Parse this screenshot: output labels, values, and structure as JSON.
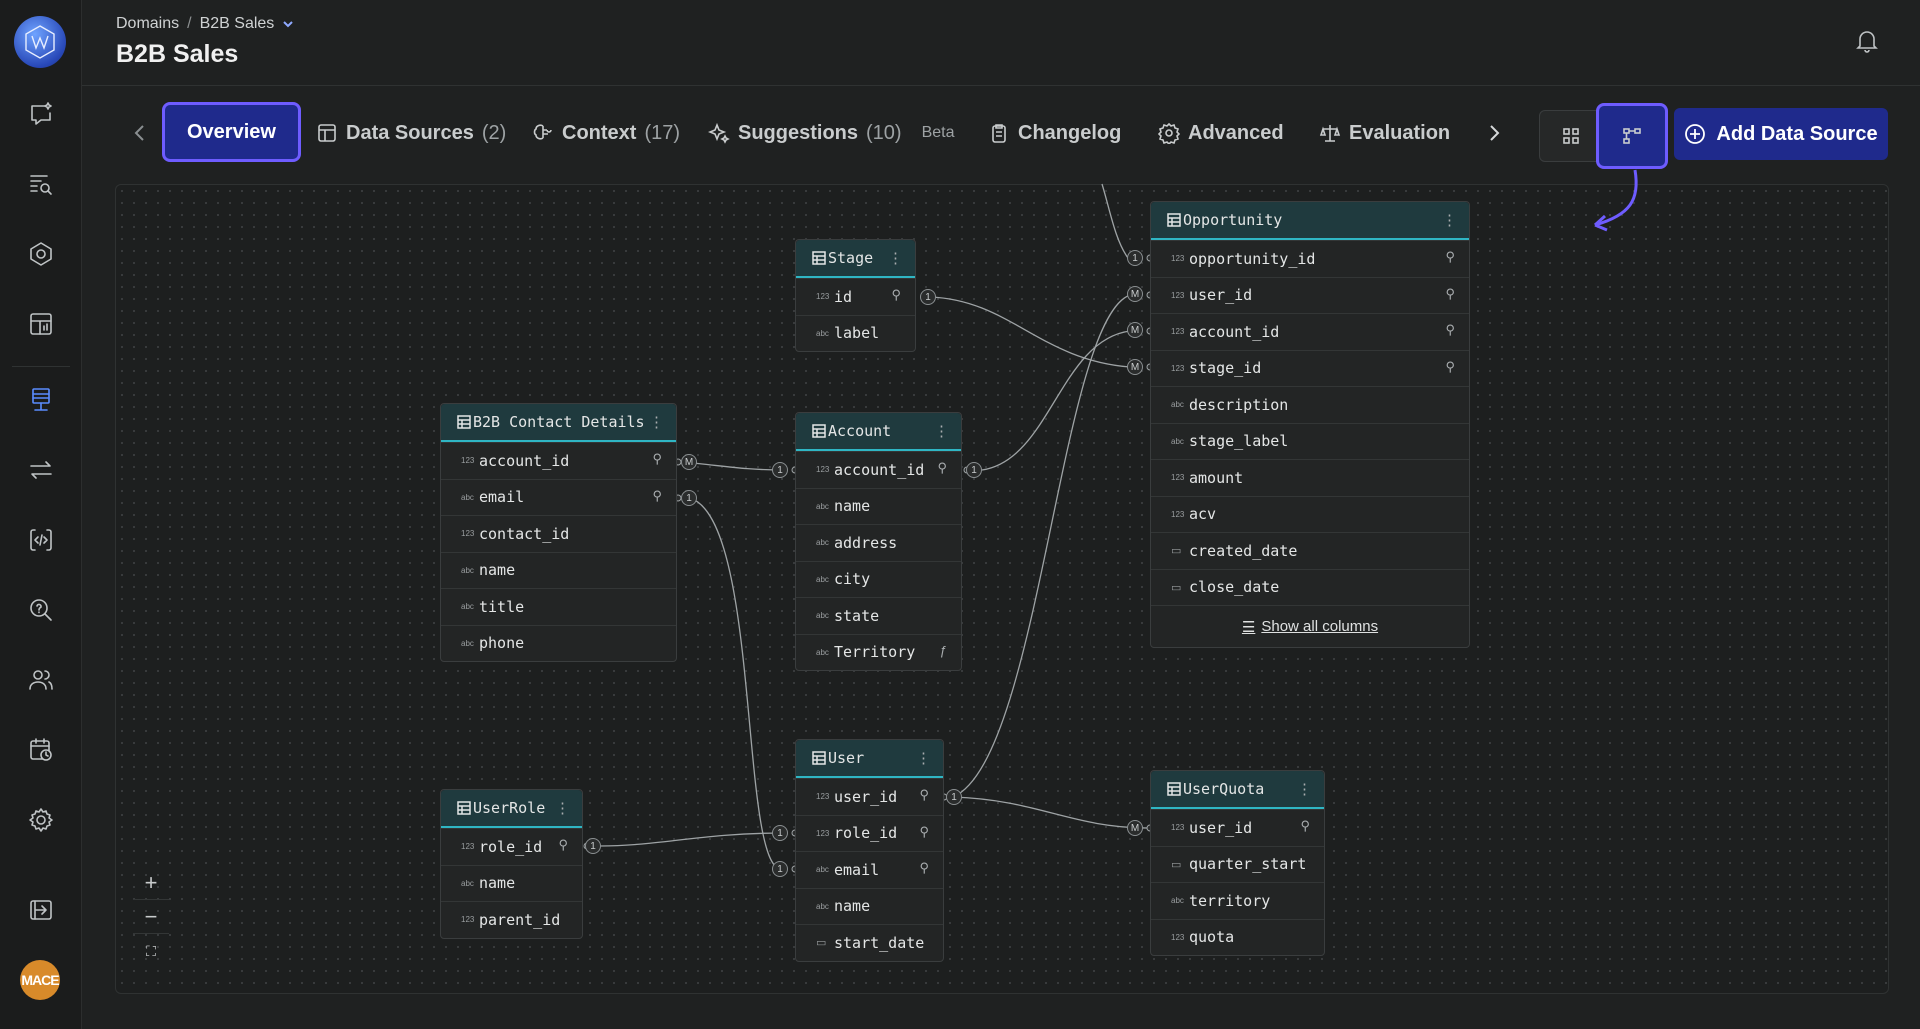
{
  "app": {
    "avatar_text": "MACE"
  },
  "sidebar": {
    "items": [
      {
        "icon": "chat-sparkle-icon"
      },
      {
        "icon": "search-list-icon"
      },
      {
        "icon": "hexagon-icon"
      },
      {
        "icon": "dashboard-icon"
      },
      {
        "icon": "domain-icon"
      },
      {
        "icon": "transfer-icon"
      },
      {
        "icon": "code-icon"
      },
      {
        "icon": "help-search-icon"
      },
      {
        "icon": "users-icon"
      },
      {
        "icon": "schedule-icon"
      },
      {
        "icon": "settings-icon"
      },
      {
        "icon": "logout-icon"
      }
    ]
  },
  "header": {
    "breadcrumb_root": "Domains",
    "breadcrumb_sep": "/",
    "breadcrumb_current": "B2B Sales",
    "title": "B2B Sales"
  },
  "tabs": {
    "overview": "Overview",
    "data_sources": "Data Sources",
    "data_sources_count": "(2)",
    "context": "Context",
    "context_count": "(17)",
    "suggestions": "Suggestions",
    "suggestions_count": "(10)",
    "beta": "Beta",
    "changelog": "Changelog",
    "advanced": "Advanced",
    "evaluation": "Evaluation"
  },
  "add_button": "Add Data Source",
  "show_all": "Show all columns",
  "zoom": {
    "in": "+",
    "out": "−",
    "fit": "⛶"
  },
  "tables": {
    "stage": {
      "name": "Stage",
      "cols": [
        {
          "t": "123",
          "n": "id",
          "k": true
        },
        {
          "t": "abc",
          "n": "label"
        }
      ]
    },
    "b2b": {
      "name": "B2B Contact Details",
      "cols": [
        {
          "t": "123",
          "n": "account_id",
          "k": true
        },
        {
          "t": "abc",
          "n": "email",
          "k": true
        },
        {
          "t": "123",
          "n": "contact_id"
        },
        {
          "t": "abc",
          "n": "name"
        },
        {
          "t": "abc",
          "n": "title"
        },
        {
          "t": "abc",
          "n": "phone"
        }
      ]
    },
    "account": {
      "name": "Account",
      "cols": [
        {
          "t": "123",
          "n": "account_id",
          "k": true
        },
        {
          "t": "abc",
          "n": "name"
        },
        {
          "t": "abc",
          "n": "address"
        },
        {
          "t": "abc",
          "n": "city"
        },
        {
          "t": "abc",
          "n": "state"
        },
        {
          "t": "abc",
          "n": "Territory",
          "f": true
        }
      ]
    },
    "opportunity": {
      "name": "Opportunity",
      "cols": [
        {
          "t": "123",
          "n": "opportunity_id",
          "k": true
        },
        {
          "t": "123",
          "n": "user_id",
          "k": true
        },
        {
          "t": "123",
          "n": "account_id",
          "k": true
        },
        {
          "t": "123",
          "n": "stage_id",
          "k": true
        },
        {
          "t": "abc",
          "n": "description"
        },
        {
          "t": "abc",
          "n": "stage_label"
        },
        {
          "t": "123",
          "n": "amount"
        },
        {
          "t": "123",
          "n": "acv"
        },
        {
          "t": "cal",
          "n": "created_date"
        },
        {
          "t": "cal",
          "n": "close_date"
        }
      ]
    },
    "userrole": {
      "name": "UserRole",
      "cols": [
        {
          "t": "123",
          "n": "role_id",
          "k": true
        },
        {
          "t": "abc",
          "n": "name"
        },
        {
          "t": "123",
          "n": "parent_id"
        }
      ]
    },
    "user": {
      "name": "User",
      "cols": [
        {
          "t": "123",
          "n": "user_id",
          "k": true
        },
        {
          "t": "123",
          "n": "role_id",
          "k": true
        },
        {
          "t": "abc",
          "n": "email",
          "k": true
        },
        {
          "t": "abc",
          "n": "name"
        },
        {
          "t": "cal",
          "n": "start_date"
        }
      ]
    },
    "userquota": {
      "name": "UserQuota",
      "cols": [
        {
          "t": "123",
          "n": "user_id",
          "k": true
        },
        {
          "t": "cal",
          "n": "quarter_start"
        },
        {
          "t": "abc",
          "n": "territory"
        },
        {
          "t": "123",
          "n": "quota"
        }
      ]
    }
  },
  "cardinality": {
    "one": "1",
    "many": "M"
  }
}
